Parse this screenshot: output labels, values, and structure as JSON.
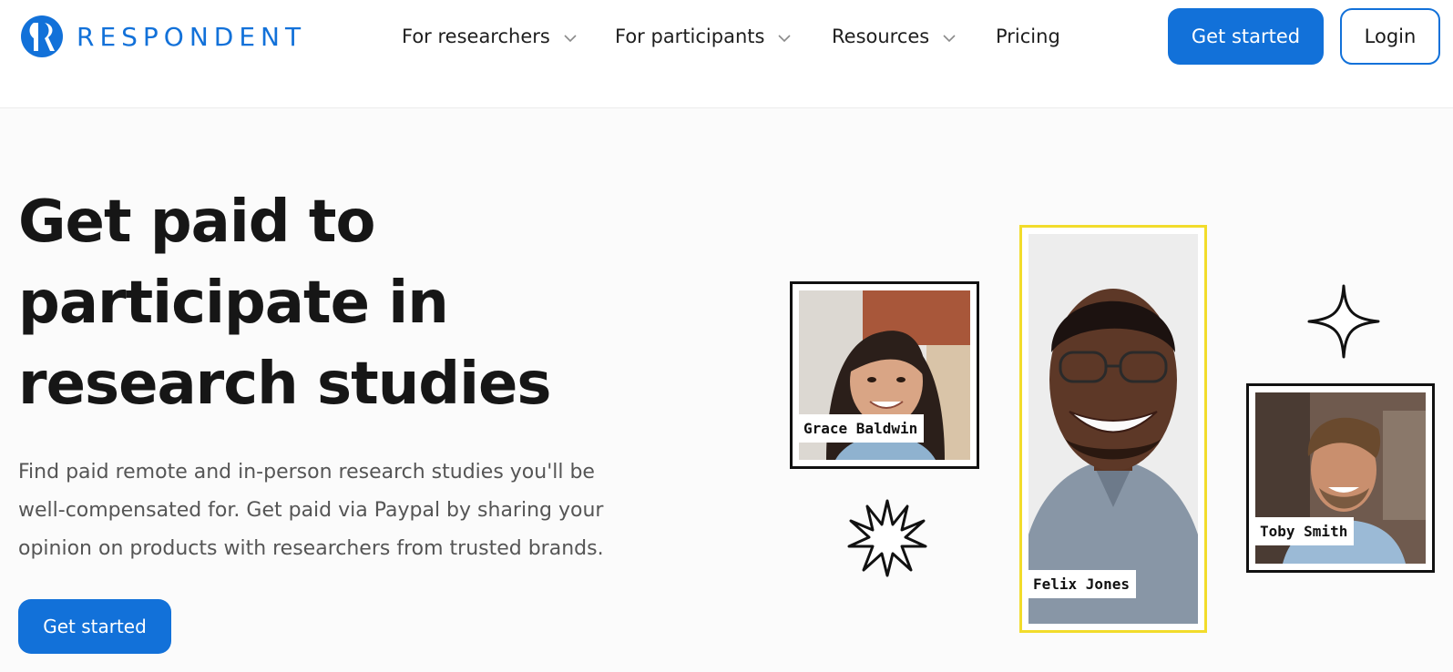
{
  "brand": {
    "name": "RESPONDENT",
    "color": "#1271d9",
    "logo_icon": "respondent-logo-icon"
  },
  "nav": {
    "items": [
      {
        "label": "For researchers",
        "has_dropdown": true
      },
      {
        "label": "For participants",
        "has_dropdown": true
      },
      {
        "label": "Resources",
        "has_dropdown": true
      },
      {
        "label": "Pricing",
        "has_dropdown": false
      }
    ],
    "get_started": "Get started",
    "login": "Login"
  },
  "hero": {
    "title_line1": "Get paid to",
    "title_line2": "participate in",
    "title_line3": "research studies",
    "subtitle": "Find paid remote and in-person research studies you'll be well-compensated for. Get paid via Paypal by sharing your opinion on products with researchers from trusted brands.",
    "cta": "Get started"
  },
  "people": [
    {
      "name": "Grace Baldwin",
      "frame_color": "#111111"
    },
    {
      "name": "Felix Jones",
      "frame_color": "#f2dc2b"
    },
    {
      "name": "Toby Smith",
      "frame_color": "#111111"
    }
  ],
  "decorations": [
    "sparkle-icon",
    "starburst-icon"
  ]
}
